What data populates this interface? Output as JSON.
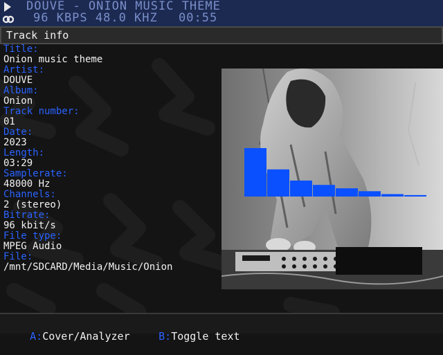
{
  "header": {
    "marquee": "DOUVE - ONION MUSIC THEME",
    "stream_info": "96 KBPS 48.0 KHZ",
    "time": "00:55",
    "play_icon": "play-icon",
    "stereo_icon": "stereo-icon"
  },
  "section_title": "Track info",
  "track": [
    {
      "label": "Title:",
      "value": "Onion music theme"
    },
    {
      "label": "Artist:",
      "value": "DOUVE"
    },
    {
      "label": "Album:",
      "value": "Onion"
    },
    {
      "label": "Track number:",
      "value": "01"
    },
    {
      "label": "Date:",
      "value": "2023"
    },
    {
      "label": "Length:",
      "value": "03:29"
    },
    {
      "label": "Samplerate:",
      "value": "48000 Hz"
    },
    {
      "label": "Channels:",
      "value": "2 (stereo)"
    },
    {
      "label": "Bitrate:",
      "value": "96 kbit/s"
    },
    {
      "label": "File type:",
      "value": "MPEG Audio"
    },
    {
      "label": "File:",
      "value": "/mnt/SDCARD/Media/Music/Onion"
    }
  ],
  "analyzer": {
    "levels": [
      1.0,
      0.56,
      0.33,
      0.24,
      0.17,
      0.11,
      0.05,
      0.03
    ],
    "color": "#0a50ff"
  },
  "footer": {
    "hint_a_key": "A:",
    "hint_a_text": "Cover/Analyzer",
    "hint_b_key": "B:",
    "hint_b_text": "Toggle text"
  },
  "colors": {
    "accent": "#2a63ff",
    "header_bg": "#1c2a52",
    "header_text": "#7a8ec9"
  }
}
